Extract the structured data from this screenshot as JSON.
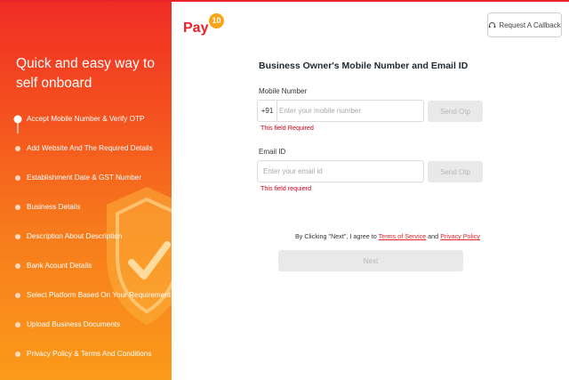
{
  "brand": {
    "logo_text": "Pay",
    "logo_badge": "10"
  },
  "header": {
    "callback_label": "Request A Callback",
    "callback_icon": "headset-icon"
  },
  "sidebar": {
    "title": "Quick and easy way to self onboard",
    "steps": [
      {
        "label": "Accept Mobile Number & Verify OTP",
        "active": true
      },
      {
        "label": "Add Website And The Required Details",
        "active": false
      },
      {
        "label": "Establishment Date & GST Number",
        "active": false
      },
      {
        "label": "Business Details",
        "active": false
      },
      {
        "label": "Description About Description",
        "active": false
      },
      {
        "label": "Bank Acount Details",
        "active": false
      },
      {
        "label": "Select Platform Based On Your Requirement",
        "active": false
      },
      {
        "label": "Upload Business Documents",
        "active": false
      },
      {
        "label": "Privacy Policy & Terms And Conditions",
        "active": false
      }
    ]
  },
  "form": {
    "title": "Business Owner's Mobile Number and Email ID",
    "mobile": {
      "label": "Mobile Number",
      "prefix": "+91",
      "value": "",
      "placeholder": "Enter your mobile number",
      "error": "This field Required",
      "send_otp_label": "Send Otp"
    },
    "email": {
      "label": "Email ID",
      "value": "",
      "placeholder": "Enter your email id",
      "error": "This field requierd",
      "send_otp_label": "Send Otp"
    },
    "consent": {
      "prefix": "By Clicking \"Next\", I agree to ",
      "terms_link": "Terms of Service",
      "and": " and ",
      "privacy_link": "Privacy Policy"
    },
    "next_label": "Next"
  },
  "colors": {
    "accent": "#e8232a",
    "sidebar_gradient_top": "#f02c25",
    "sidebar_gradient_bottom": "#fb9b1a",
    "error": "#d0021b",
    "disabled_button": "#e9e9e9"
  }
}
